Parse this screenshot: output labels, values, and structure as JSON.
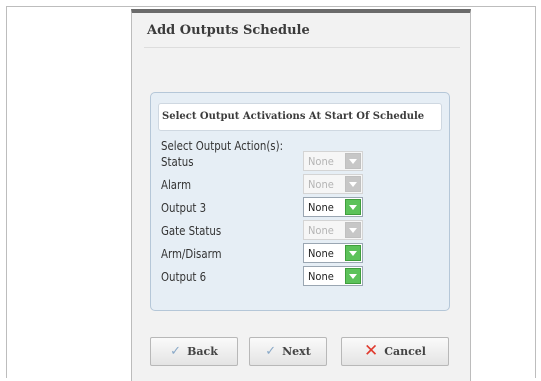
{
  "dialog": {
    "title": "Add Outputs Schedule",
    "panel_title": "Select Output Activations At Start Of Schedule",
    "select_label": "Select Output Action(s):",
    "rows": [
      {
        "label": "Status",
        "value": "None",
        "enabled": false
      },
      {
        "label": "Alarm",
        "value": "None",
        "enabled": false
      },
      {
        "label": "Output 3",
        "value": "None",
        "enabled": true
      },
      {
        "label": "Gate Status",
        "value": "None",
        "enabled": false
      },
      {
        "label": "Arm/Disarm",
        "value": "None",
        "enabled": true
      },
      {
        "label": "Output 6",
        "value": "None",
        "enabled": true
      }
    ]
  },
  "buttons": {
    "back": "Back",
    "next": "Next",
    "cancel": "Cancel"
  },
  "icons": {
    "back": "check-icon",
    "next": "check-icon",
    "cancel": "x-icon",
    "dropdown": "chevron-down-icon"
  },
  "colors": {
    "dropdown_enabled": "#5cc25a",
    "dropdown_disabled": "#c7c7c7",
    "cancel_icon": "#e03a2e",
    "panel_bg": "#e6eef5"
  }
}
